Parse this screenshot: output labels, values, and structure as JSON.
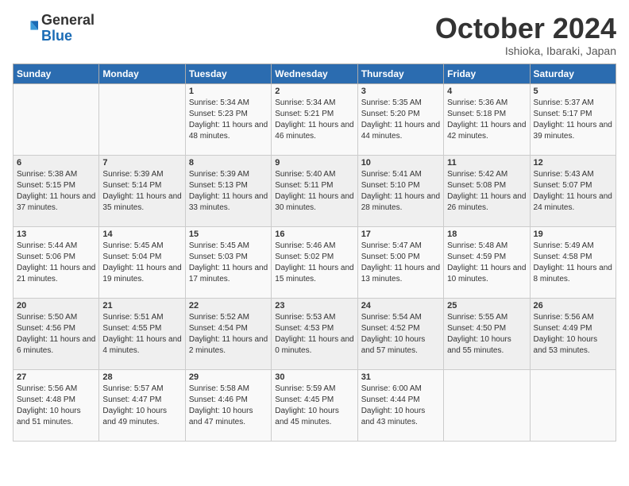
{
  "header": {
    "logo_line1": "General",
    "logo_line2": "Blue",
    "month": "October 2024",
    "location": "Ishioka, Ibaraki, Japan"
  },
  "days_of_week": [
    "Sunday",
    "Monday",
    "Tuesday",
    "Wednesday",
    "Thursday",
    "Friday",
    "Saturday"
  ],
  "weeks": [
    [
      {
        "day": "",
        "info": ""
      },
      {
        "day": "",
        "info": ""
      },
      {
        "day": "1",
        "info": "Sunrise: 5:34 AM\nSunset: 5:23 PM\nDaylight: 11 hours and 48 minutes."
      },
      {
        "day": "2",
        "info": "Sunrise: 5:34 AM\nSunset: 5:21 PM\nDaylight: 11 hours and 46 minutes."
      },
      {
        "day": "3",
        "info": "Sunrise: 5:35 AM\nSunset: 5:20 PM\nDaylight: 11 hours and 44 minutes."
      },
      {
        "day": "4",
        "info": "Sunrise: 5:36 AM\nSunset: 5:18 PM\nDaylight: 11 hours and 42 minutes."
      },
      {
        "day": "5",
        "info": "Sunrise: 5:37 AM\nSunset: 5:17 PM\nDaylight: 11 hours and 39 minutes."
      }
    ],
    [
      {
        "day": "6",
        "info": "Sunrise: 5:38 AM\nSunset: 5:15 PM\nDaylight: 11 hours and 37 minutes."
      },
      {
        "day": "7",
        "info": "Sunrise: 5:39 AM\nSunset: 5:14 PM\nDaylight: 11 hours and 35 minutes."
      },
      {
        "day": "8",
        "info": "Sunrise: 5:39 AM\nSunset: 5:13 PM\nDaylight: 11 hours and 33 minutes."
      },
      {
        "day": "9",
        "info": "Sunrise: 5:40 AM\nSunset: 5:11 PM\nDaylight: 11 hours and 30 minutes."
      },
      {
        "day": "10",
        "info": "Sunrise: 5:41 AM\nSunset: 5:10 PM\nDaylight: 11 hours and 28 minutes."
      },
      {
        "day": "11",
        "info": "Sunrise: 5:42 AM\nSunset: 5:08 PM\nDaylight: 11 hours and 26 minutes."
      },
      {
        "day": "12",
        "info": "Sunrise: 5:43 AM\nSunset: 5:07 PM\nDaylight: 11 hours and 24 minutes."
      }
    ],
    [
      {
        "day": "13",
        "info": "Sunrise: 5:44 AM\nSunset: 5:06 PM\nDaylight: 11 hours and 21 minutes."
      },
      {
        "day": "14",
        "info": "Sunrise: 5:45 AM\nSunset: 5:04 PM\nDaylight: 11 hours and 19 minutes."
      },
      {
        "day": "15",
        "info": "Sunrise: 5:45 AM\nSunset: 5:03 PM\nDaylight: 11 hours and 17 minutes."
      },
      {
        "day": "16",
        "info": "Sunrise: 5:46 AM\nSunset: 5:02 PM\nDaylight: 11 hours and 15 minutes."
      },
      {
        "day": "17",
        "info": "Sunrise: 5:47 AM\nSunset: 5:00 PM\nDaylight: 11 hours and 13 minutes."
      },
      {
        "day": "18",
        "info": "Sunrise: 5:48 AM\nSunset: 4:59 PM\nDaylight: 11 hours and 10 minutes."
      },
      {
        "day": "19",
        "info": "Sunrise: 5:49 AM\nSunset: 4:58 PM\nDaylight: 11 hours and 8 minutes."
      }
    ],
    [
      {
        "day": "20",
        "info": "Sunrise: 5:50 AM\nSunset: 4:56 PM\nDaylight: 11 hours and 6 minutes."
      },
      {
        "day": "21",
        "info": "Sunrise: 5:51 AM\nSunset: 4:55 PM\nDaylight: 11 hours and 4 minutes."
      },
      {
        "day": "22",
        "info": "Sunrise: 5:52 AM\nSunset: 4:54 PM\nDaylight: 11 hours and 2 minutes."
      },
      {
        "day": "23",
        "info": "Sunrise: 5:53 AM\nSunset: 4:53 PM\nDaylight: 11 hours and 0 minutes."
      },
      {
        "day": "24",
        "info": "Sunrise: 5:54 AM\nSunset: 4:52 PM\nDaylight: 10 hours and 57 minutes."
      },
      {
        "day": "25",
        "info": "Sunrise: 5:55 AM\nSunset: 4:50 PM\nDaylight: 10 hours and 55 minutes."
      },
      {
        "day": "26",
        "info": "Sunrise: 5:56 AM\nSunset: 4:49 PM\nDaylight: 10 hours and 53 minutes."
      }
    ],
    [
      {
        "day": "27",
        "info": "Sunrise: 5:56 AM\nSunset: 4:48 PM\nDaylight: 10 hours and 51 minutes."
      },
      {
        "day": "28",
        "info": "Sunrise: 5:57 AM\nSunset: 4:47 PM\nDaylight: 10 hours and 49 minutes."
      },
      {
        "day": "29",
        "info": "Sunrise: 5:58 AM\nSunset: 4:46 PM\nDaylight: 10 hours and 47 minutes."
      },
      {
        "day": "30",
        "info": "Sunrise: 5:59 AM\nSunset: 4:45 PM\nDaylight: 10 hours and 45 minutes."
      },
      {
        "day": "31",
        "info": "Sunrise: 6:00 AM\nSunset: 4:44 PM\nDaylight: 10 hours and 43 minutes."
      },
      {
        "day": "",
        "info": ""
      },
      {
        "day": "",
        "info": ""
      }
    ]
  ]
}
